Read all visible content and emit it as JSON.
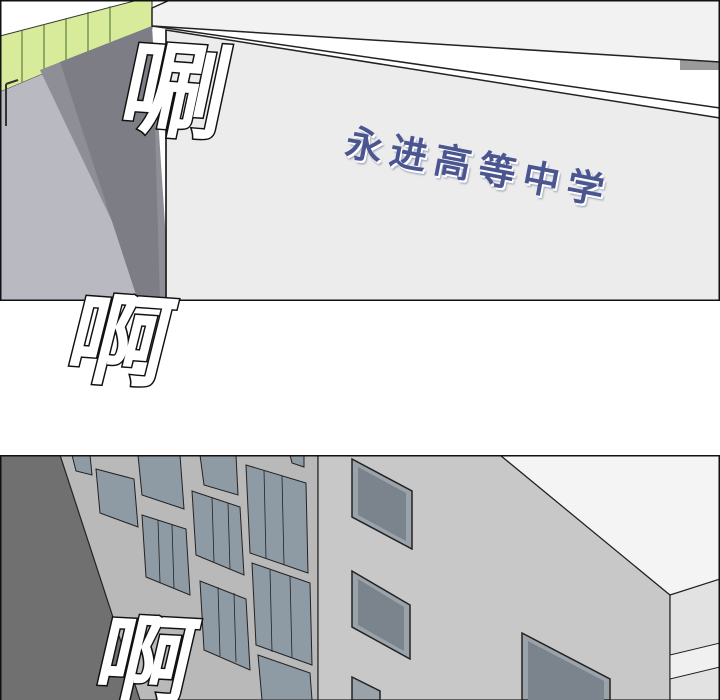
{
  "panel_top": {
    "sfx_text": "唰",
    "school_sign": "永进高等中学"
  },
  "gutter": {
    "sfx_text": "啊"
  },
  "panel_bottom": {
    "sfx_text": "啊"
  },
  "colors": {
    "ink": "#111111",
    "sky": "#ffffff",
    "wall_light": "#e6e6e6",
    "wall_shadow": "#7a7a7a",
    "pavement": "#b8b8c0",
    "fence_green": "#d7eb9a",
    "sign_blue": "#4b5590"
  }
}
